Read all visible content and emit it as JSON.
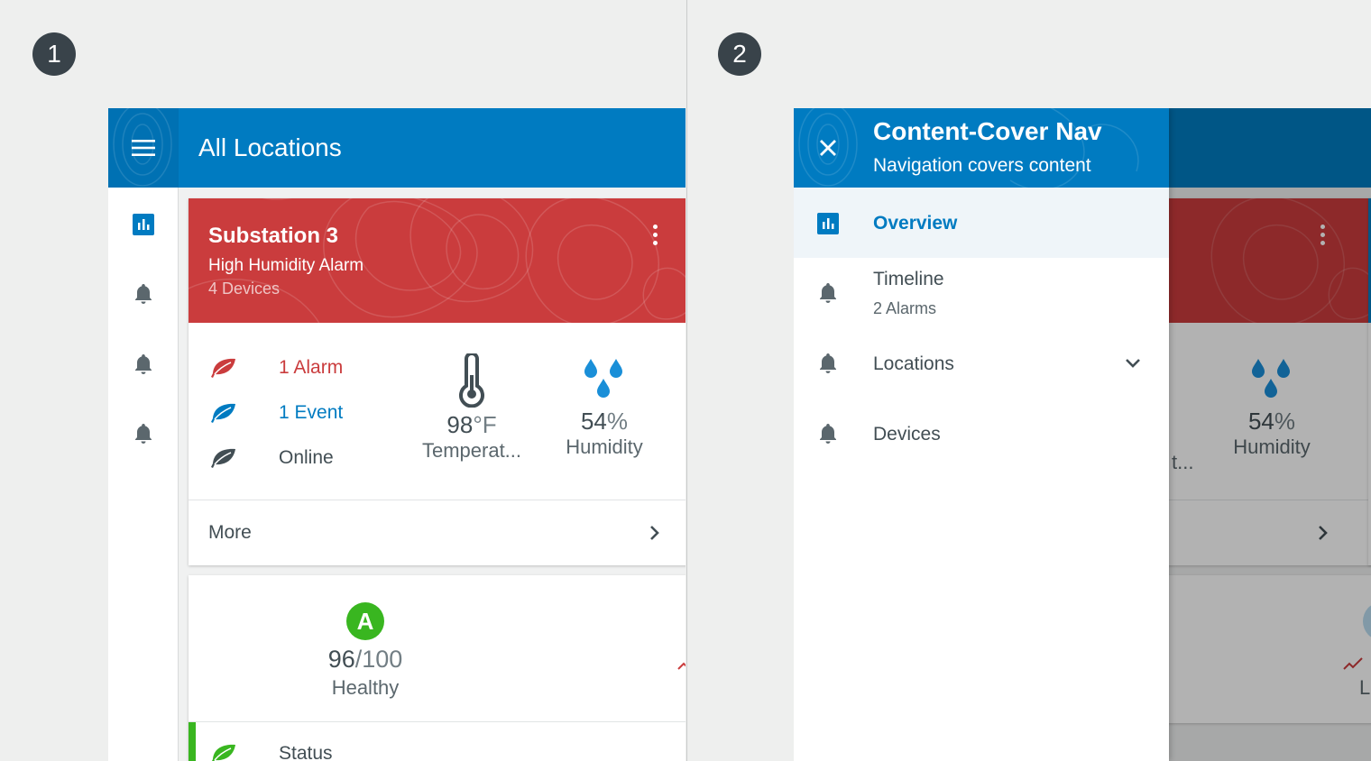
{
  "colors": {
    "primary": "#007bc1",
    "alarm": "#ca3c3d",
    "event": "#007bc1",
    "online": "#424e54",
    "grade": "#39b620",
    "trend": "#ca3c3d"
  },
  "steps": [
    "1",
    "2"
  ],
  "panel1": {
    "header": {
      "title": "All Locations",
      "menu_icon": "hamburger-menu-icon"
    },
    "rail": [
      {
        "icon": "overview-chart-icon",
        "active": true
      },
      {
        "icon": "bell-icon",
        "active": false
      },
      {
        "icon": "bell-icon",
        "active": false
      },
      {
        "icon": "bell-icon",
        "active": false
      }
    ],
    "card": {
      "title": "Substation 3",
      "subtitle": "High Humidity Alarm",
      "device_count": "4 Devices",
      "statuses": [
        {
          "label": "1 Alarm",
          "icon": "leaf-icon",
          "color": "#ca3c3d"
        },
        {
          "label": "1 Event",
          "icon": "leaf-icon",
          "color": "#007bc1"
        },
        {
          "label": "Online",
          "icon": "leaf-icon",
          "color": "#424e54"
        }
      ],
      "temperature": {
        "value": "98",
        "unit": "°F",
        "label": "Temperat..."
      },
      "humidity": {
        "value": "54",
        "unit": "%",
        "label": "Humidity"
      },
      "more_label": "More"
    },
    "score_card": {
      "grade": "A",
      "score": "96",
      "max": "/100",
      "label": "Healthy",
      "status_label": "Status"
    }
  },
  "panel2": {
    "drawer": {
      "title": "Content-Cover Nav",
      "subtitle": "Navigation covers content",
      "items": [
        {
          "label": "Overview",
          "icon": "overview-chart-icon",
          "active": true
        },
        {
          "label": "Timeline",
          "sub": "2 Alarms",
          "icon": "bell-icon"
        },
        {
          "label": "Locations",
          "icon": "bell-icon",
          "expandable": true
        },
        {
          "label": "Devices",
          "icon": "bell-icon"
        }
      ]
    },
    "background": {
      "temperature_label_tail": "t...",
      "humidity_value": "54",
      "humidity_unit": "%",
      "humidity_label": "Humidity",
      "trend_label": "L"
    }
  }
}
